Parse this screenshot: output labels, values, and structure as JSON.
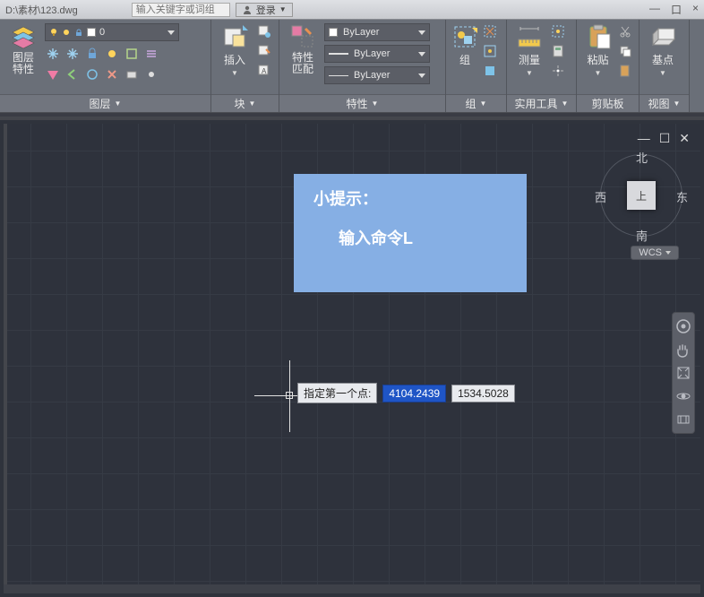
{
  "tabstrip": {
    "filepath": "D:\\素材\\123.dwg",
    "search_placeholder": "输入关键字或词组",
    "login": "登录",
    "minus": "—",
    "sq": "口",
    "x": "×"
  },
  "ribbon": {
    "layer_panel": {
      "big_label": "图层\n特性",
      "combo_value": "0",
      "footer": "图层"
    },
    "block_panel": {
      "big_label": "插入",
      "footer": "块"
    },
    "props_panel": {
      "big_label": "特性\n匹配",
      "bylayer": "ByLayer",
      "footer": "特性"
    },
    "group_panel": {
      "big_label": "组",
      "footer": "组"
    },
    "util_panel": {
      "big_label": "测量",
      "footer": "实用工具"
    },
    "clip_panel": {
      "big_label": "粘贴",
      "footer": "剪贴板"
    },
    "view_panel": {
      "big_label": "基点",
      "footer": "视图"
    }
  },
  "viewport": {
    "winctl": {
      "min": "—",
      "max": "☐",
      "close": "✕"
    },
    "viewcube": {
      "n": "北",
      "s": "南",
      "e": "东",
      "w": "西",
      "top": "上"
    },
    "wcs": "WCS"
  },
  "dyn": {
    "prompt": "指定第一个点:",
    "x": "4104.2439",
    "y": "1534.5028"
  },
  "tip": {
    "title": "小提示：",
    "body": "输入命令L"
  }
}
